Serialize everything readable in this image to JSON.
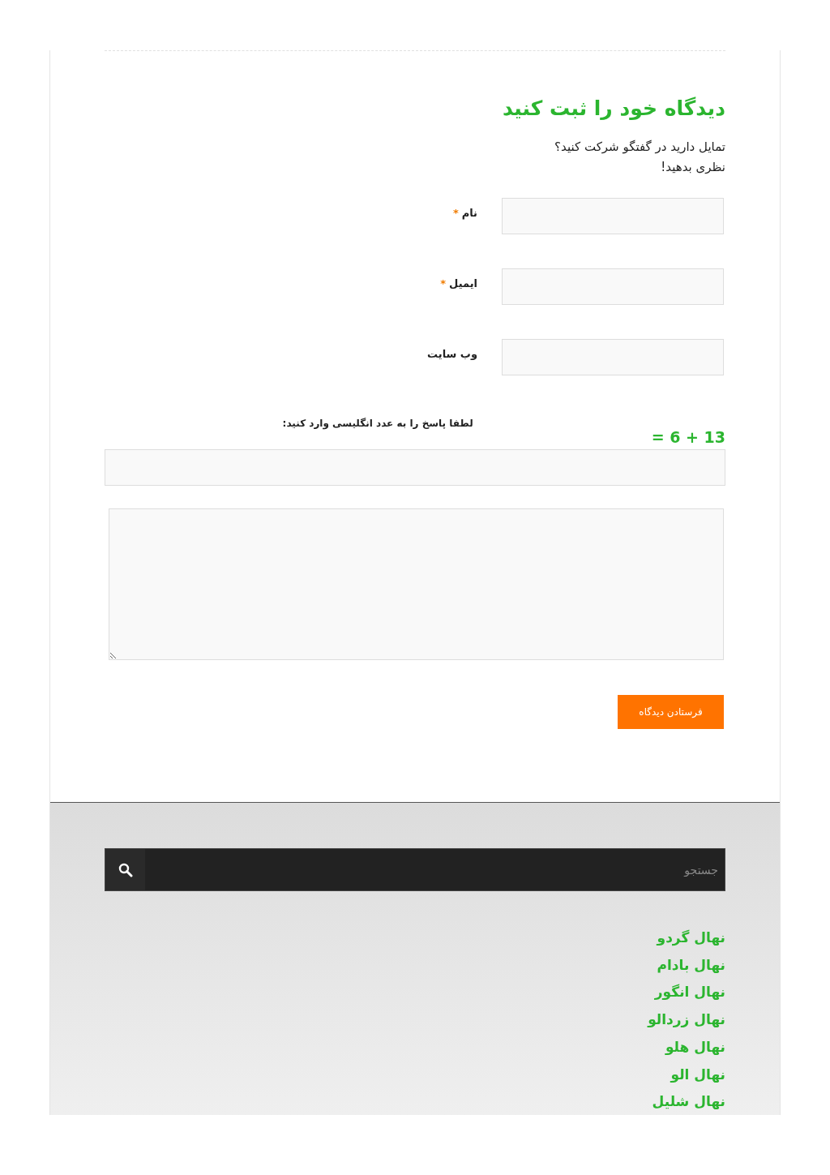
{
  "comment_form": {
    "title": "دیدگاه خود را ثبت کنید",
    "intro": [
      "تمایل دارید در گفتگو شرکت کنید؟",
      "نظری بدهید!"
    ],
    "fields": [
      {
        "label": "نام",
        "required_mark": "*"
      },
      {
        "label": "ایمیل",
        "required_mark": "*"
      },
      {
        "label": "وب سایت"
      }
    ],
    "captcha": {
      "label": "لطفا پاسخ را به عدد انگلیسی وارد کنید:",
      "question": "= 6 + 13"
    },
    "submit": "فرستادن دیدگاه"
  },
  "footer": {
    "search": {
      "placeholder": "جستجو"
    },
    "links": [
      "نهال گردو",
      "نهال بادام",
      "نهال انگور",
      "نهال زردالو",
      "نهال هلو",
      "نهال الو",
      "نهال شلیل"
    ]
  }
}
